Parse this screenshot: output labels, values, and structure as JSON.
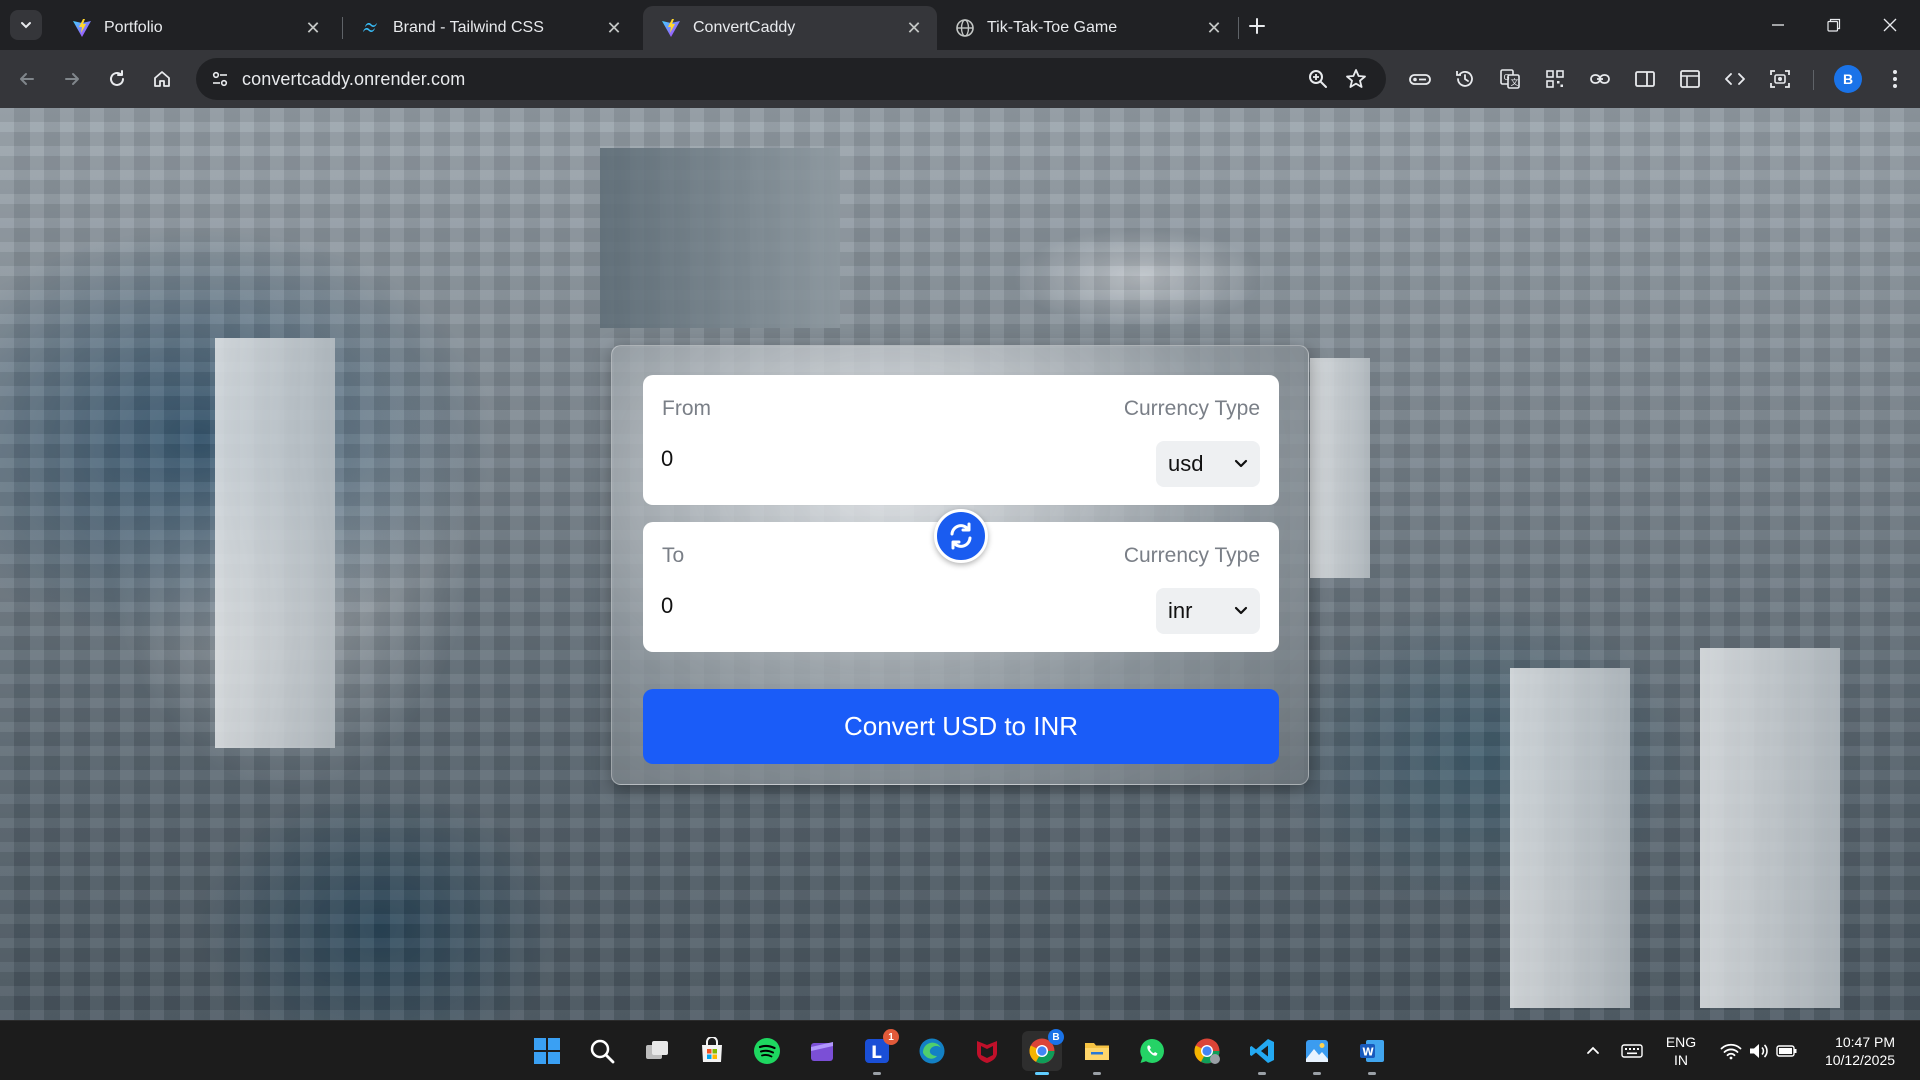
{
  "browser": {
    "tabs": [
      {
        "title": "Portfolio",
        "favicon": "vite-logo-icon",
        "active": false
      },
      {
        "title": "Brand - Tailwind CSS",
        "favicon": "tailwind-logo-icon",
        "active": false
      },
      {
        "title": "ConvertCaddy",
        "favicon": "vite-logo-icon",
        "active": true
      },
      {
        "title": "Tik-Tak-Toe Game",
        "favicon": "globe-icon",
        "active": false
      }
    ],
    "url": "convertcaddy.onrender.com",
    "profile_initial": "B"
  },
  "converter": {
    "from": {
      "label": "From",
      "currency_label": "Currency Type",
      "amount": "0",
      "currency": "usd"
    },
    "to": {
      "label": "To",
      "currency_label": "Currency Type",
      "amount": "0",
      "currency": "inr"
    },
    "swap_icon": "swap-arrows-icon",
    "convert_button": "Convert USD to INR",
    "accent_color": "#1a5cf8"
  },
  "taskbar": {
    "apps": [
      "start-icon",
      "search-icon",
      "task-view-icon",
      "microsoft-store-icon",
      "spotify-icon",
      "clipchamp-icon",
      "launcher-icon",
      "edge-icon",
      "mcafee-icon",
      "chrome-icon",
      "file-explorer-icon",
      "whatsapp-icon",
      "chrome-alt-icon",
      "vscode-icon",
      "paint-icon",
      "word-icon"
    ],
    "badges": {
      "launcher": "1",
      "chrome": "B"
    },
    "language_line1": "ENG",
    "language_line2": "IN",
    "time": "10:47 PM",
    "date": "10/12/2025"
  }
}
